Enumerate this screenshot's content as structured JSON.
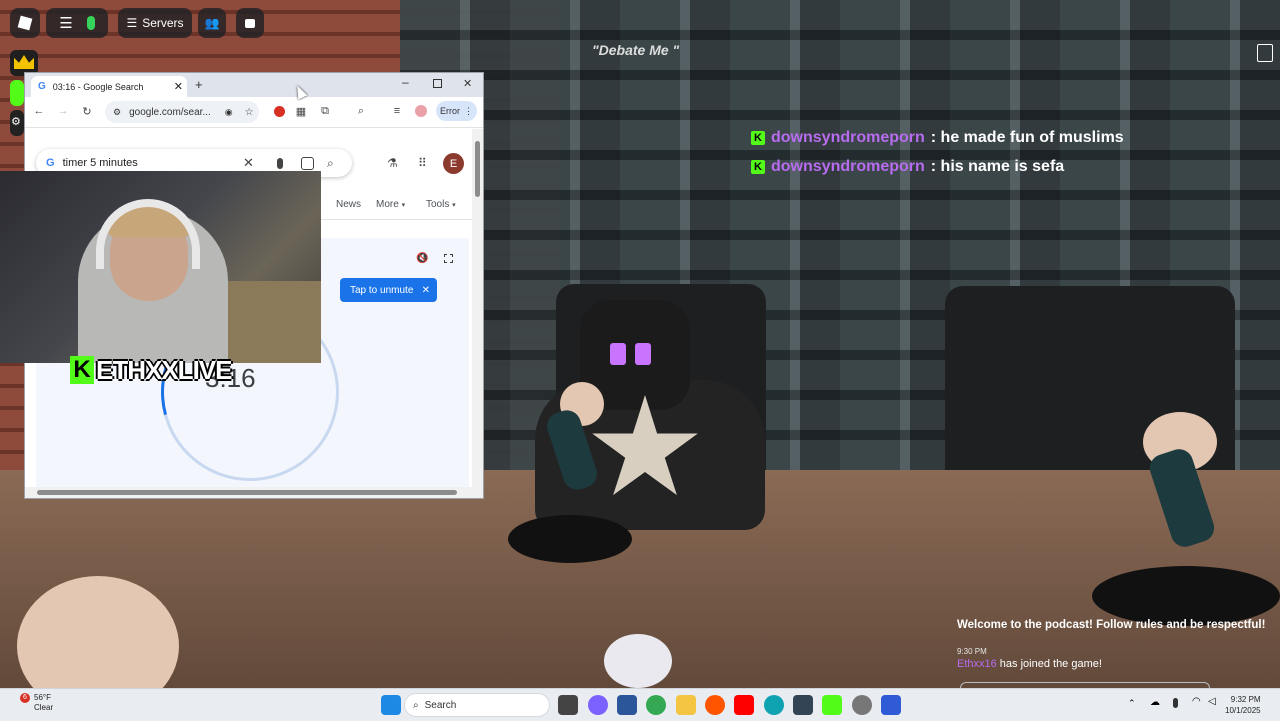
{
  "roblox": {
    "servers_label": "Servers",
    "debate_title": "\"Debate Me \"",
    "chat": [
      {
        "user": "downsyndromeporn",
        "text": ": he made fun of muslims"
      },
      {
        "user": "downsyndromeporn",
        "text": ": his name is sefa"
      }
    ],
    "welcome": "Welcome to the podcast! Follow rules and be respectful!",
    "system_time": "9:30 PM",
    "join_user": "Ethxx16",
    "join_text": " has joined the game!"
  },
  "chrome": {
    "tab_title": "03:16 - Google Search",
    "address": "google.com/sear...",
    "error_label": "Error",
    "search_query": "timer 5 minutes",
    "account_initial": "E",
    "nav": {
      "news": "News",
      "more": "More",
      "tools": "Tools"
    },
    "unmute_label": "Tap to unmute",
    "timer_value": "3:16"
  },
  "overlay": {
    "kick_letter": "K",
    "streamer_name": "ETHXXLIVE"
  },
  "taskbar": {
    "weather_temp": "56°F",
    "weather_cond": "Clear",
    "weather_badge": "6",
    "search_label": "Search",
    "time": "9:32 PM",
    "date": "10/1/2025"
  },
  "colors": {
    "kick_green": "#53fc18",
    "chat_user": "#b86cf0",
    "chrome_blue": "#1a73e8"
  }
}
